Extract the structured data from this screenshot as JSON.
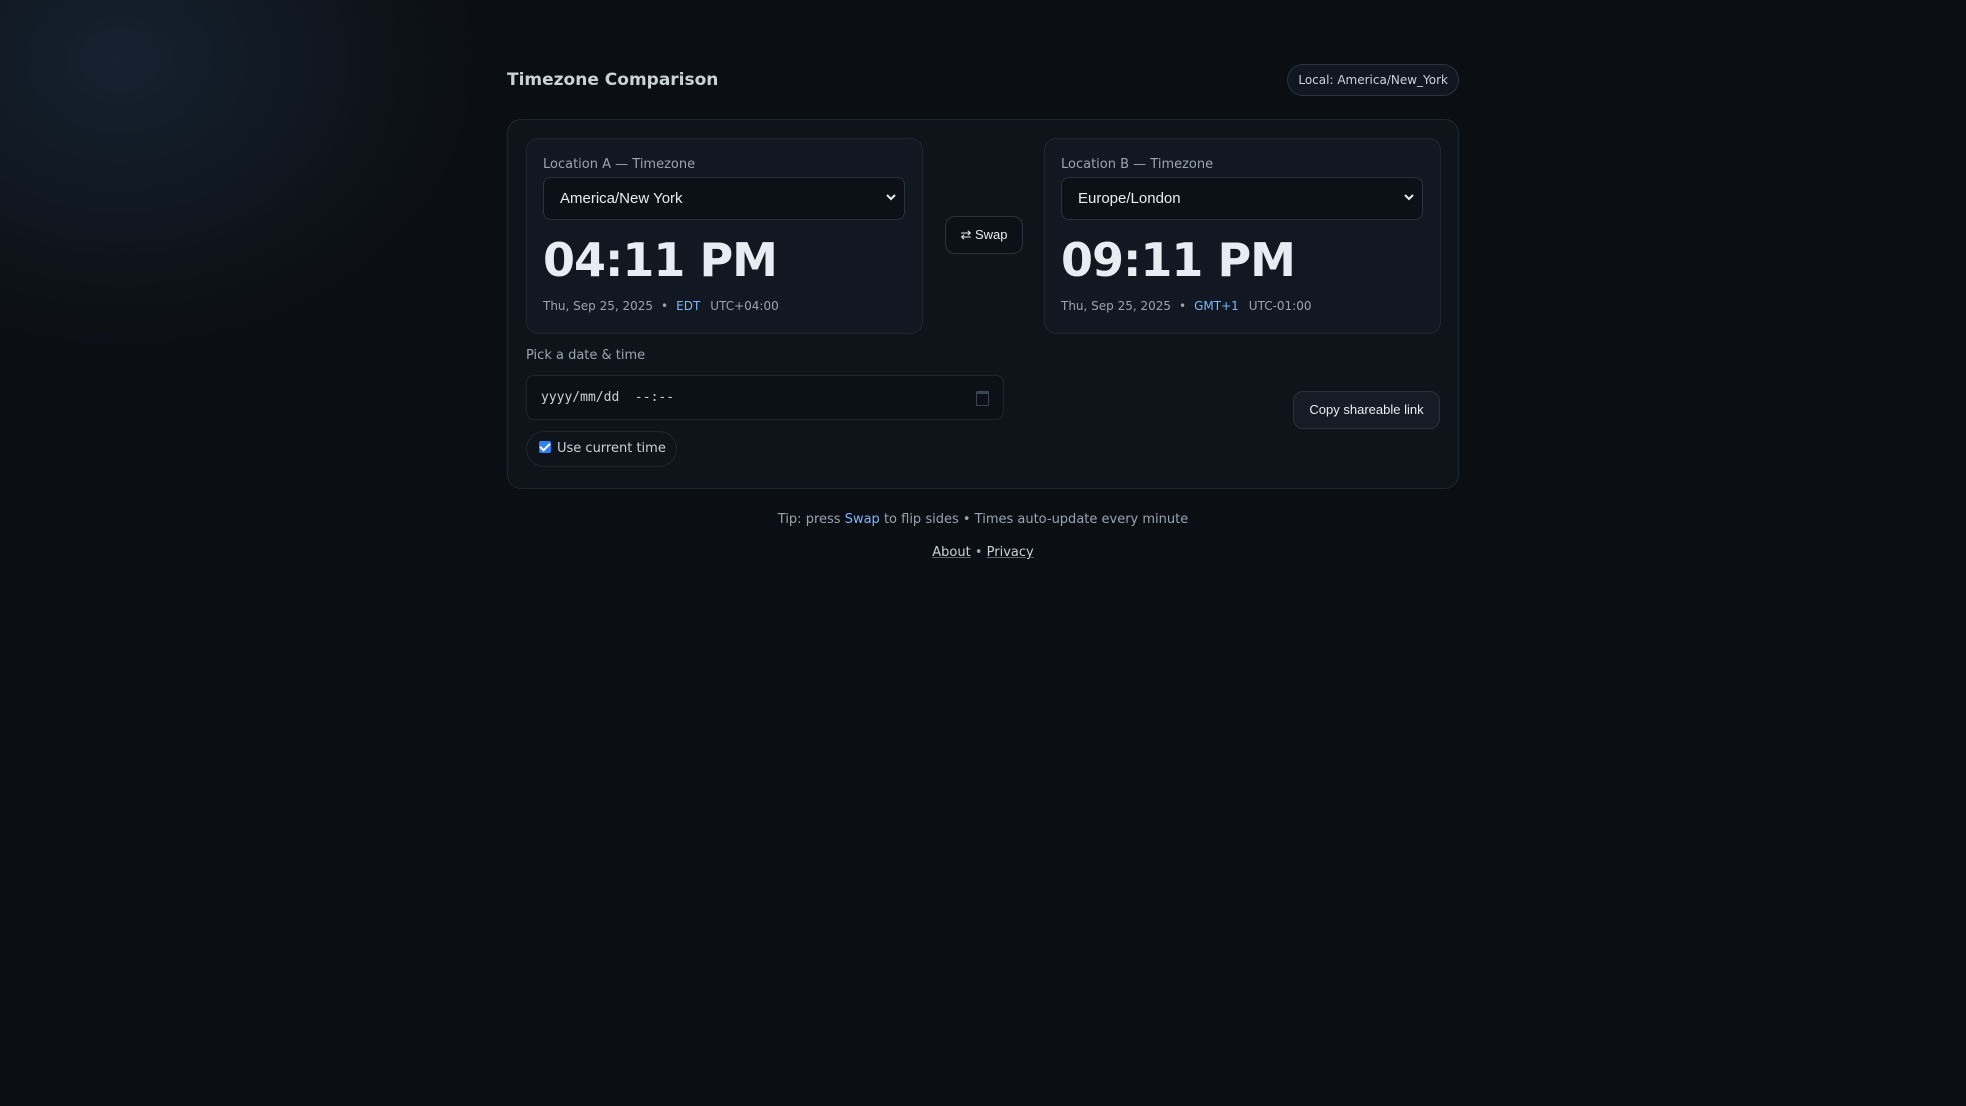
{
  "header": {
    "title": "Timezone Comparison",
    "local_badge": "Local: America/New_York"
  },
  "location_a": {
    "label": "Location A — Timezone",
    "selected_timezone": "America/New York",
    "time": "04:11 PM",
    "date": "Thu, Sep 25, 2025",
    "abbreviation": "EDT",
    "offset": "UTC+04:00"
  },
  "location_b": {
    "label": "Location B — Timezone",
    "selected_timezone": "Europe/London",
    "time": "09:11 PM",
    "date": "Thu, Sep 25, 2025",
    "abbreviation": "GMT+1",
    "offset": "UTC-01:00"
  },
  "swap_button": {
    "icon": "swap-arrows-icon",
    "glyph": "⇄",
    "label": "Swap"
  },
  "datetime_picker": {
    "label": "Pick a date & time",
    "placeholder": "yyyy/mm/dd  --:--"
  },
  "use_current_time": {
    "label": "Use current time",
    "checked": true
  },
  "copy_button": {
    "label": "Copy shareable link"
  },
  "tip": {
    "prefix": "Tip: press",
    "highlight": "Swap",
    "suffix": "to flip sides • Times auto-update every minute"
  },
  "footer": {
    "about": "About",
    "separator": "•",
    "privacy": "Privacy"
  },
  "colors": {
    "background": "#0b0e13",
    "accent": "#79b8ff",
    "checkbox": "#2f81f7"
  }
}
